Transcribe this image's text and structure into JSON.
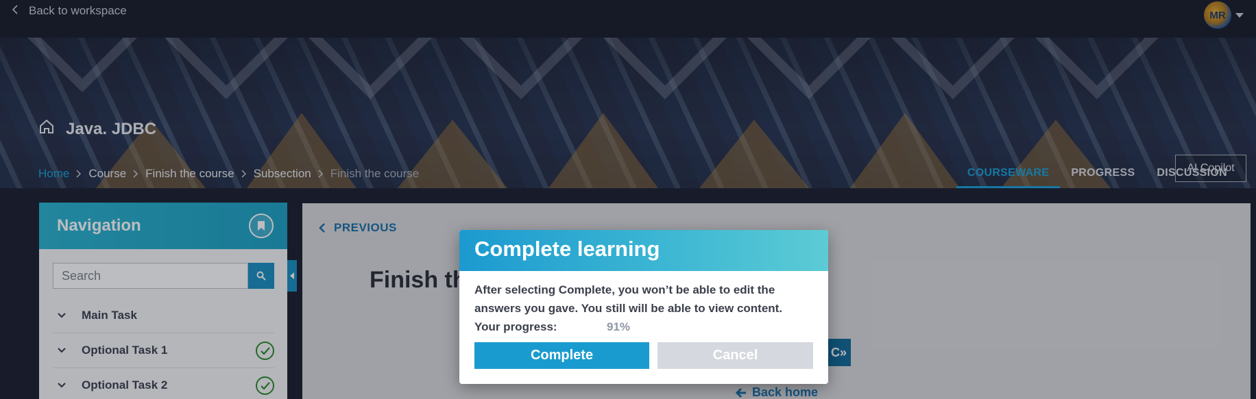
{
  "topbar": {
    "back_label": "Back to workspace",
    "avatar_initials": "MR"
  },
  "hero": {
    "course_title": "Java. JDBC",
    "breadcrumb": [
      "Home",
      "Course",
      "Finish the course",
      "Subsection",
      "Finish the course"
    ],
    "ai_copilot_label": "AI Copilot",
    "tabs": [
      {
        "label": "COURSEWARE",
        "active": true
      },
      {
        "label": "PROGRESS",
        "active": false
      },
      {
        "label": "DISCUSSION",
        "active": false
      }
    ]
  },
  "navigation": {
    "title": "Navigation",
    "search_placeholder": "Search",
    "items": [
      {
        "label": "Main Task",
        "completed": false
      },
      {
        "label": "Optional Task 1",
        "completed": true
      },
      {
        "label": "Optional Task 2",
        "completed": true
      }
    ]
  },
  "main": {
    "previous_label": "PREVIOUS",
    "heading": "Finish th",
    "hidden_button_label": "C»",
    "back_home_label": "Back home"
  },
  "modal": {
    "title": "Complete learning",
    "text": "After selecting Complete, you won’t be able to edit the answers you gave. You still will be able to view content.",
    "progress_label": "Your progress:",
    "progress_value": "91%",
    "complete_label": "Complete",
    "cancel_label": "Cancel"
  },
  "colors": {
    "accent": "#1a9bd0",
    "success": "#2e8a2a",
    "topbar_bg": "#1a1e2b"
  }
}
